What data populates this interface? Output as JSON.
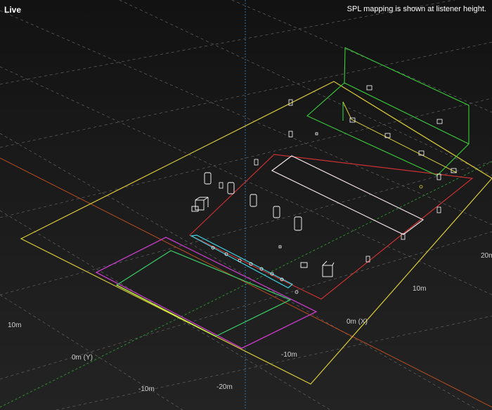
{
  "viewport": {
    "mode_label": "Live",
    "spl_note": "SPL mapping is shown at listener height."
  },
  "axis_labels": {
    "x_10m": "10m",
    "x_0m": "0m (X)",
    "x_20m": "20m",
    "y_10m": "10m",
    "y_0m": "0m (Y)",
    "y_neg10m": "-10m",
    "y_neg20m": "-20m",
    "z_neg10m": "-10m"
  },
  "colors": {
    "background": "#1a1a1a",
    "grid": "#5a5a5a",
    "axis_x": "#c8521e",
    "axis_y": "#2f9a2f",
    "axis_z": "#2a7fc0",
    "floor_outline": "#d8c93a",
    "audience_zone": "#c83232",
    "balcony_zone": "#38d038",
    "stage_outline": "#c83cc8",
    "stage_inner": "#3ccf6a",
    "speaker_array": "#40d0e0",
    "mapping_plane": "#f0e0e8",
    "loudspeaker": "#ffffff"
  }
}
